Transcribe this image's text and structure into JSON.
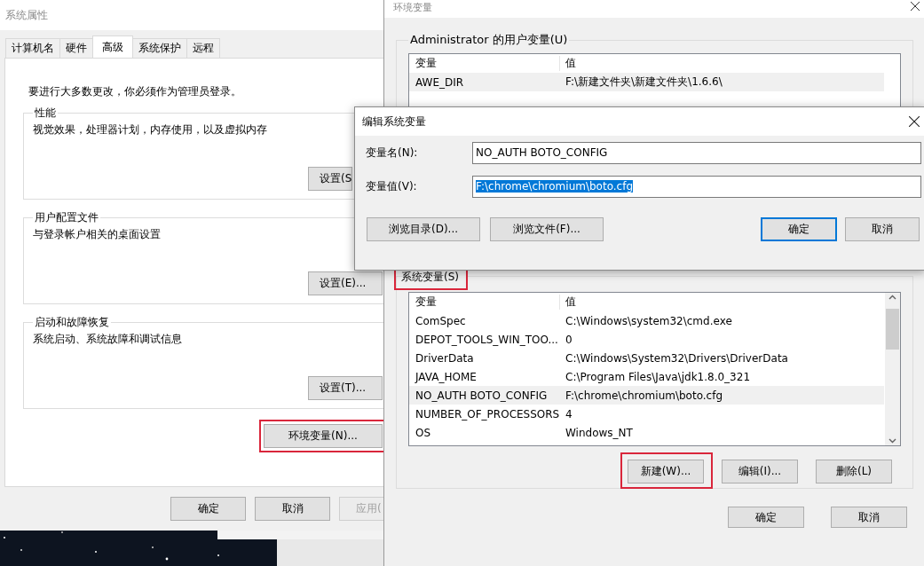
{
  "system_properties": {
    "title": "系统属性",
    "tabs": [
      {
        "label": "计算机名",
        "selected": false
      },
      {
        "label": "硬件",
        "selected": false
      },
      {
        "label": "高级",
        "selected": true
      },
      {
        "label": "系统保护",
        "selected": false
      },
      {
        "label": "远程",
        "selected": false
      }
    ],
    "notice": "要进行大多数更改，你必须作为管理员登录。",
    "groups": [
      {
        "title": "性能",
        "description": "视觉效果，处理器计划，内存使用，以及虚拟内存",
        "button": "设置(S"
      },
      {
        "title": "用户配置文件",
        "description": "与登录帐户相关的桌面设置",
        "button": "设置(E)..."
      },
      {
        "title": "启动和故障恢复",
        "description": "系统启动、系统故障和调试信息",
        "button": "设置(T)..."
      }
    ],
    "env_button": {
      "label": "环境变量(N)...",
      "highlighted": true
    },
    "buttons": [
      {
        "label": "确定",
        "disabled": false
      },
      {
        "label": "取消",
        "disabled": false
      },
      {
        "label": "应用(",
        "disabled": true
      }
    ]
  },
  "environment_variables": {
    "title": "环境变量",
    "user_group": {
      "title": "Administrator 的用户变量(U)",
      "columns": [
        "变量",
        "值"
      ],
      "rows": [
        {
          "name": "AWE_DIR",
          "value": "F:\\新建文件夹\\新建文件夹\\1.6.6\\",
          "selected": true
        }
      ]
    },
    "system_group": {
      "title": "系统变量(S)",
      "highlighted": true,
      "columns": [
        "变量",
        "值"
      ],
      "rows": [
        {
          "name": "ComSpec",
          "value": "C:\\Windows\\system32\\cmd.exe",
          "selected": false
        },
        {
          "name": "DEPOT_TOOLS_WIN_TOO...",
          "value": "0",
          "selected": false
        },
        {
          "name": "DriverData",
          "value": "C:\\Windows\\System32\\Drivers\\DriverData",
          "selected": false
        },
        {
          "name": "JAVA_HOME",
          "value": "C:\\Program Files\\Java\\jdk1.8.0_321",
          "selected": false
        },
        {
          "name": "NO_AUTH BOTO_CONFIG",
          "value": "F:\\chrome\\chromium\\boto.cfg",
          "selected": true
        },
        {
          "name": "NUMBER_OF_PROCESSORS",
          "value": "4",
          "selected": false
        },
        {
          "name": "OS",
          "value": "Windows_NT",
          "selected": false
        }
      ],
      "buttons": [
        {
          "label": "新建(W)...",
          "highlighted": true
        },
        {
          "label": "编辑(I)...",
          "highlighted": false
        },
        {
          "label": "删除(L)",
          "highlighted": false
        }
      ]
    },
    "buttons": [
      {
        "label": "确定"
      },
      {
        "label": "取消"
      }
    ]
  },
  "edit_dialog": {
    "title": "编辑系统变量",
    "fields": [
      {
        "label": "变量名(N):",
        "value": "NO_AUTH BOTO_CONFIG",
        "text_selected": false
      },
      {
        "label": "变量值(V):",
        "value": "F:\\chrome\\chromium\\boto.cfg",
        "text_selected": true
      }
    ],
    "buttons": [
      {
        "label": "浏览目录(D)...",
        "default": false
      },
      {
        "label": "浏览文件(F)...",
        "default": false
      },
      {
        "label": "确定",
        "default": true
      },
      {
        "label": "取消",
        "default": false
      }
    ]
  }
}
